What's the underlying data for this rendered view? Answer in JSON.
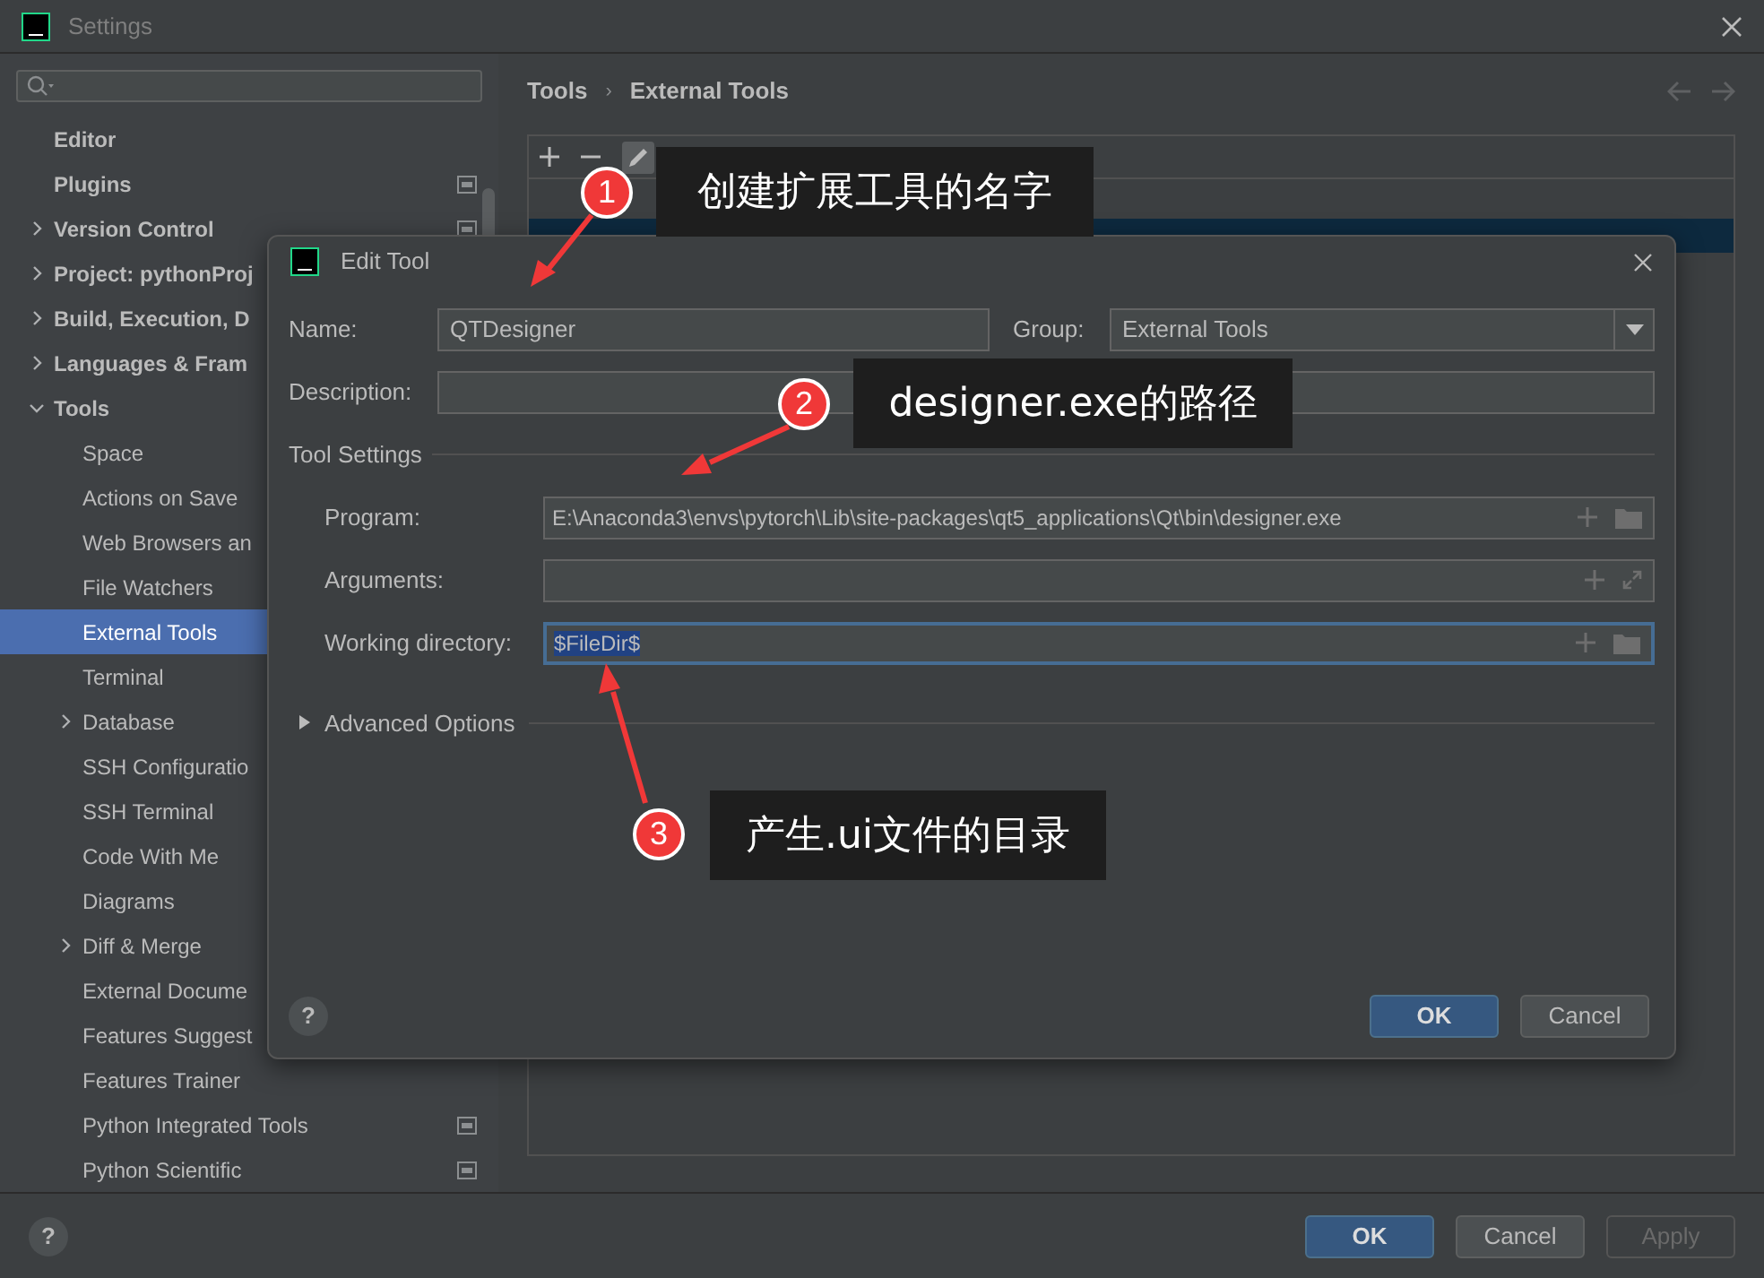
{
  "window": {
    "title": "Settings"
  },
  "sidebar": {
    "items": [
      {
        "label": "Editor",
        "selected": false
      },
      {
        "label": "Plugins",
        "selected": false,
        "marker": true
      },
      {
        "label": "Version Control",
        "selected": false,
        "marker": true,
        "expanded": false
      },
      {
        "label": "Project: pythonProj",
        "selected": false,
        "expanded": false
      },
      {
        "label": "Build, Execution, D",
        "selected": false,
        "expanded": false
      },
      {
        "label": "Languages & Fram",
        "selected": false,
        "expanded": false
      },
      {
        "label": "Tools",
        "selected": false,
        "expanded": true,
        "children": [
          {
            "label": "Space",
            "selected": false
          },
          {
            "label": "Actions on Save",
            "selected": false
          },
          {
            "label": "Web Browsers an",
            "selected": false
          },
          {
            "label": "File Watchers",
            "selected": false
          },
          {
            "label": "External Tools",
            "selected": true
          },
          {
            "label": "Terminal",
            "selected": false
          },
          {
            "label": "Database",
            "selected": false,
            "expanded": false
          },
          {
            "label": "SSH Configuratio",
            "selected": false
          },
          {
            "label": "SSH Terminal",
            "selected": false
          },
          {
            "label": "Code With Me",
            "selected": false
          },
          {
            "label": "Diagrams",
            "selected": false
          },
          {
            "label": "Diff & Merge",
            "selected": false,
            "expanded": false
          },
          {
            "label": "External Docume",
            "selected": false
          },
          {
            "label": "Features Suggest",
            "selected": false
          },
          {
            "label": "Features Trainer",
            "selected": false
          },
          {
            "label": "Python Integrated Tools",
            "selected": false,
            "marker": true
          },
          {
            "label": "Python Scientific",
            "selected": false,
            "marker": true
          }
        ]
      }
    ]
  },
  "breadcrumb": {
    "items": [
      "Tools",
      "External Tools"
    ],
    "separator": "›"
  },
  "help_label": "?",
  "dialog": {
    "title": "Edit Tool",
    "name": {
      "label": "Name:",
      "value": "QTDesigner"
    },
    "group": {
      "label": "Group:",
      "value": "External Tools"
    },
    "description": {
      "label": "Description:"
    },
    "section": "Tool Settings",
    "fields": [
      {
        "label": "Program:",
        "value": "E:\\Anaconda3\\envs\\pytorch\\Lib\\site-packages\\qt5_applications\\Qt\\bin\\designer.exe",
        "focused": false,
        "kind": "file"
      },
      {
        "label": "Arguments:",
        "kind": "expand",
        "focused": false
      },
      {
        "label": "Working directory:",
        "value": "$FileDir$",
        "focused": true,
        "kind": "file"
      }
    ],
    "advanced": {
      "label": "Advanced Options",
      "expanded": false
    },
    "buttons": [
      {
        "label": "OK",
        "default": true,
        "disabled": false
      },
      {
        "label": "Cancel",
        "default": false,
        "disabled": false
      }
    ],
    "help_label": "?"
  },
  "footer_buttons": [
    {
      "label": "OK",
      "default": true,
      "disabled": false
    },
    {
      "label": "Cancel",
      "default": false,
      "disabled": false
    },
    {
      "label": "Apply",
      "default": false,
      "disabled": true
    }
  ],
  "callouts": [
    {
      "number": "1",
      "text": "创建扩展工具的名字"
    },
    {
      "number": "2",
      "text": "designer.exe的路径"
    },
    {
      "number": "3",
      "text": "产生.ui文件的目录"
    }
  ]
}
